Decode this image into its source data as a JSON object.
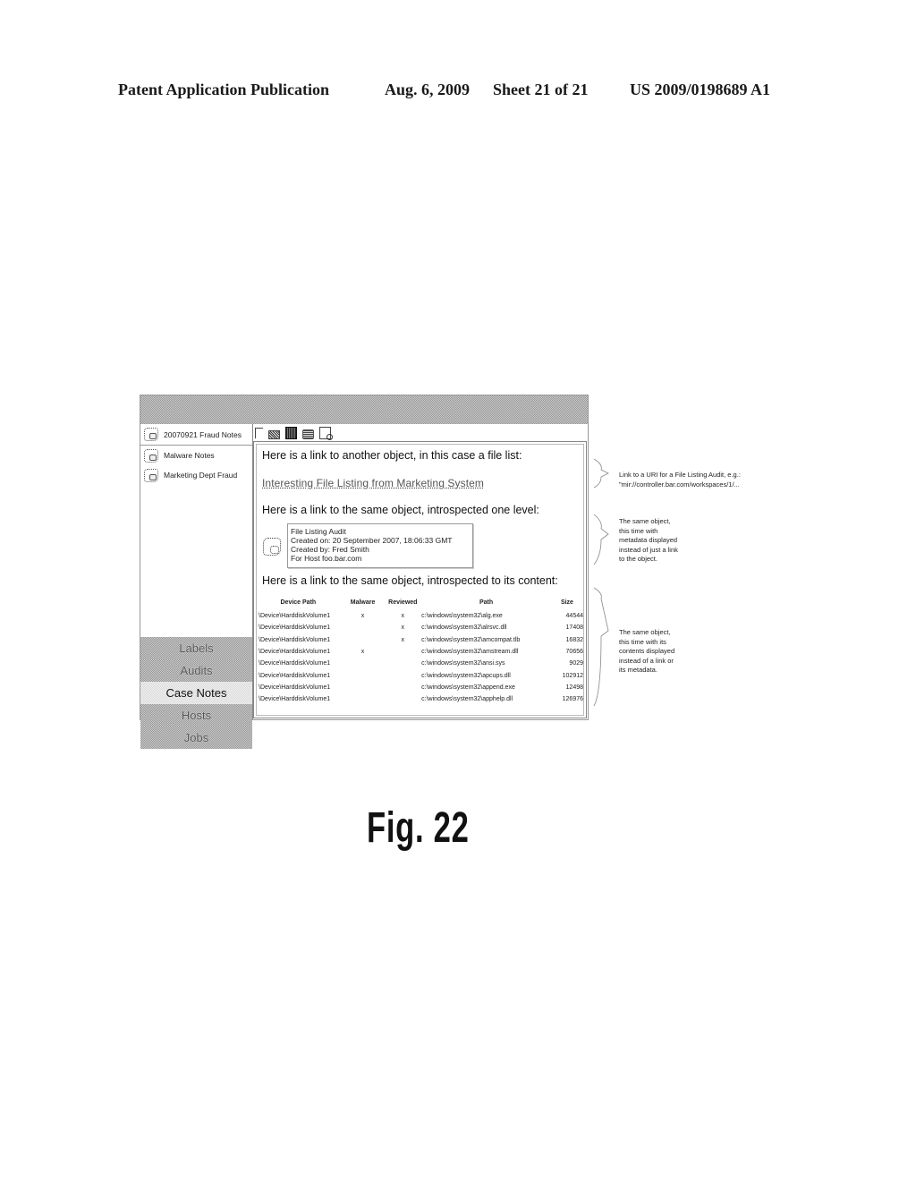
{
  "header": {
    "publication": "Patent Application Publication",
    "date": "Aug. 6, 2009",
    "sheet": "Sheet 21 of 21",
    "number": "US 2009/0198689 A1"
  },
  "sidebar": {
    "items": [
      {
        "label": "20070921 Fraud Notes",
        "icon": "note-icon",
        "selected": true
      },
      {
        "label": "Malware Notes",
        "icon": "note-icon",
        "selected": false
      },
      {
        "label": "Marketing Dept Fraud",
        "icon": "note-icon",
        "selected": false
      }
    ]
  },
  "nav": {
    "items": [
      {
        "label": "Labels",
        "active": false
      },
      {
        "label": "Audits",
        "active": false
      },
      {
        "label": "Case Notes",
        "active": true
      },
      {
        "label": "Hosts",
        "active": false
      },
      {
        "label": "Jobs",
        "active": false
      }
    ]
  },
  "toolbar": {
    "icons": [
      "new-document-icon",
      "open-folder-icon",
      "save-icon",
      "print-icon",
      "print-preview-icon"
    ]
  },
  "content": {
    "para1": "Here is a link to another object, in this case a file list:",
    "link": "Interesting File Listing from Marketing System",
    "para2": "Here is a link to the same object, introspected one level:",
    "metadata": {
      "title": "File Listing Audit",
      "created_on": "Created on: 20 September 2007, 18:06:33 GMT",
      "created_by": "Created by: Fred Smith",
      "host": "For Host foo.bar.com"
    },
    "para3": "Here is a link to the same object, introspected to its content:",
    "table": {
      "headers": [
        "Device Path",
        "Malware",
        "Reviewed",
        "Path",
        "Size"
      ],
      "rows": [
        {
          "device": "\\Device\\HarddiskVolume1",
          "malware": "x",
          "reviewed": "x",
          "path": "c:\\windows\\system32\\alg.exe",
          "size": "44544"
        },
        {
          "device": "\\Device\\HarddiskVolume1",
          "malware": "",
          "reviewed": "x",
          "path": "c:\\windows\\system32\\alrsvc.dll",
          "size": "17408"
        },
        {
          "device": "\\Device\\HarddiskVolume1",
          "malware": "",
          "reviewed": "x",
          "path": "c:\\windows\\system32\\amcompat.tlb",
          "size": "16832"
        },
        {
          "device": "\\Device\\HarddiskVolume1",
          "malware": "x",
          "reviewed": "",
          "path": "c:\\windows\\system32\\amstream.dll",
          "size": "70656"
        },
        {
          "device": "\\Device\\HarddiskVolume1",
          "malware": "",
          "reviewed": "",
          "path": "c:\\windows\\system32\\ansi.sys",
          "size": "9029"
        },
        {
          "device": "\\Device\\HarddiskVolume1",
          "malware": "",
          "reviewed": "",
          "path": "c:\\windows\\system32\\apcups.dll",
          "size": "102912"
        },
        {
          "device": "\\Device\\HarddiskVolume1",
          "malware": "",
          "reviewed": "",
          "path": "c:\\windows\\system32\\append.exe",
          "size": "12498"
        },
        {
          "device": "\\Device\\HarddiskVolume1",
          "malware": "",
          "reviewed": "",
          "path": "c:\\windows\\system32\\apphelp.dll",
          "size": "126976"
        }
      ]
    }
  },
  "annotations": [
    {
      "lines": [
        "Link to a URI for a File Listing Audit, e.g.:",
        "\"mir://controller.bar.com/workspaces/1/..."
      ]
    },
    {
      "lines": [
        "The same object,",
        "this time with",
        "metadata displayed",
        "instead of just a link",
        "to the object."
      ]
    },
    {
      "lines": [
        "The same object,",
        "this time with its",
        "contents displayed",
        "instead of a link or",
        "its metadata."
      ]
    }
  ],
  "figure_label": "Fig. 22"
}
